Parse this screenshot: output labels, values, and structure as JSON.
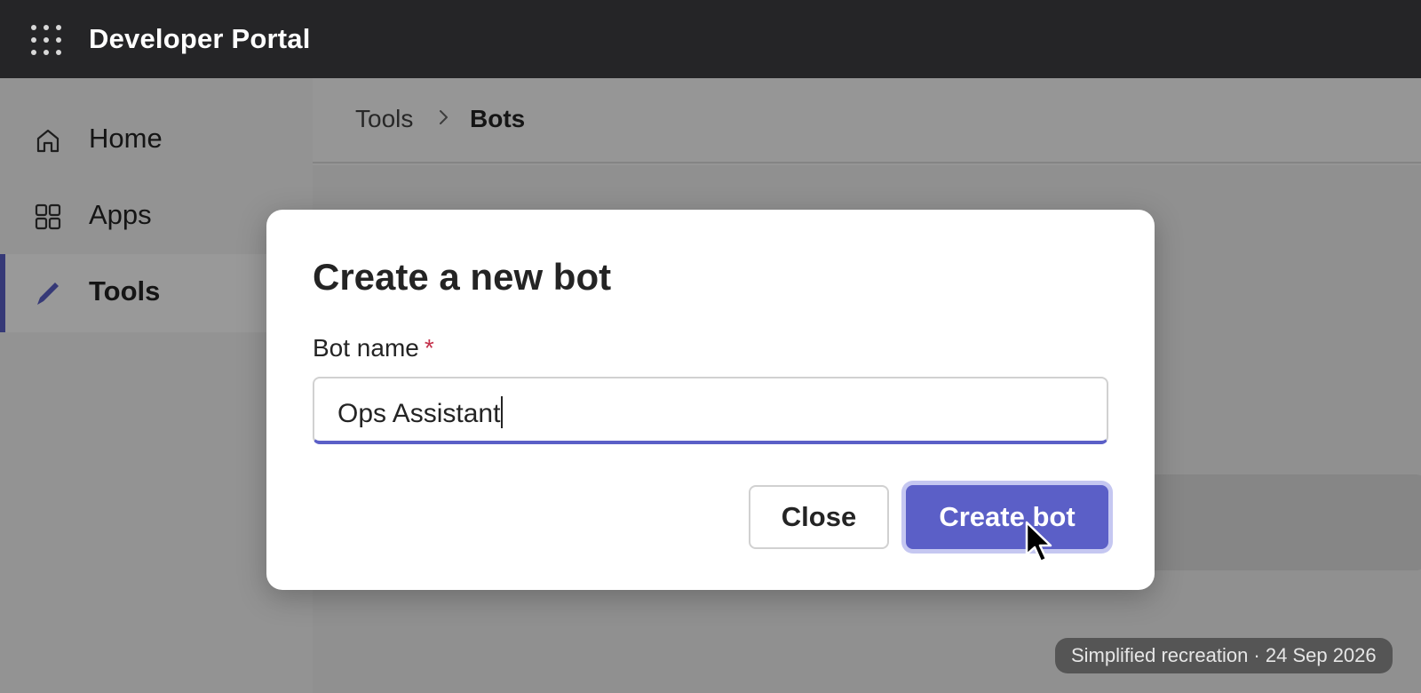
{
  "header": {
    "app_title": "Developer Portal",
    "launcher_icon": "app-launcher-icon"
  },
  "sidebar": {
    "items": [
      {
        "label": "Home",
        "icon": "home-icon",
        "active": false
      },
      {
        "label": "Apps",
        "icon": "apps-grid-icon",
        "active": false
      },
      {
        "label": "Tools",
        "icon": "pencil-icon",
        "active": true
      }
    ]
  },
  "breadcrumb": {
    "items": [
      "Tools",
      "Bots"
    ],
    "separator_icon": "chevron-right-icon"
  },
  "dialog": {
    "title": "Create a new bot",
    "field_label": "Bot name",
    "required_marker": "*",
    "input_value": "Ops Assistant",
    "close_label": "Close",
    "create_label": "Create bot"
  },
  "footer": {
    "badge_text": "Simplified recreation · 24 Sep 2026"
  },
  "colors": {
    "accent": "#5b5fc7",
    "topbar": "#252527",
    "required": "#c4314b"
  }
}
